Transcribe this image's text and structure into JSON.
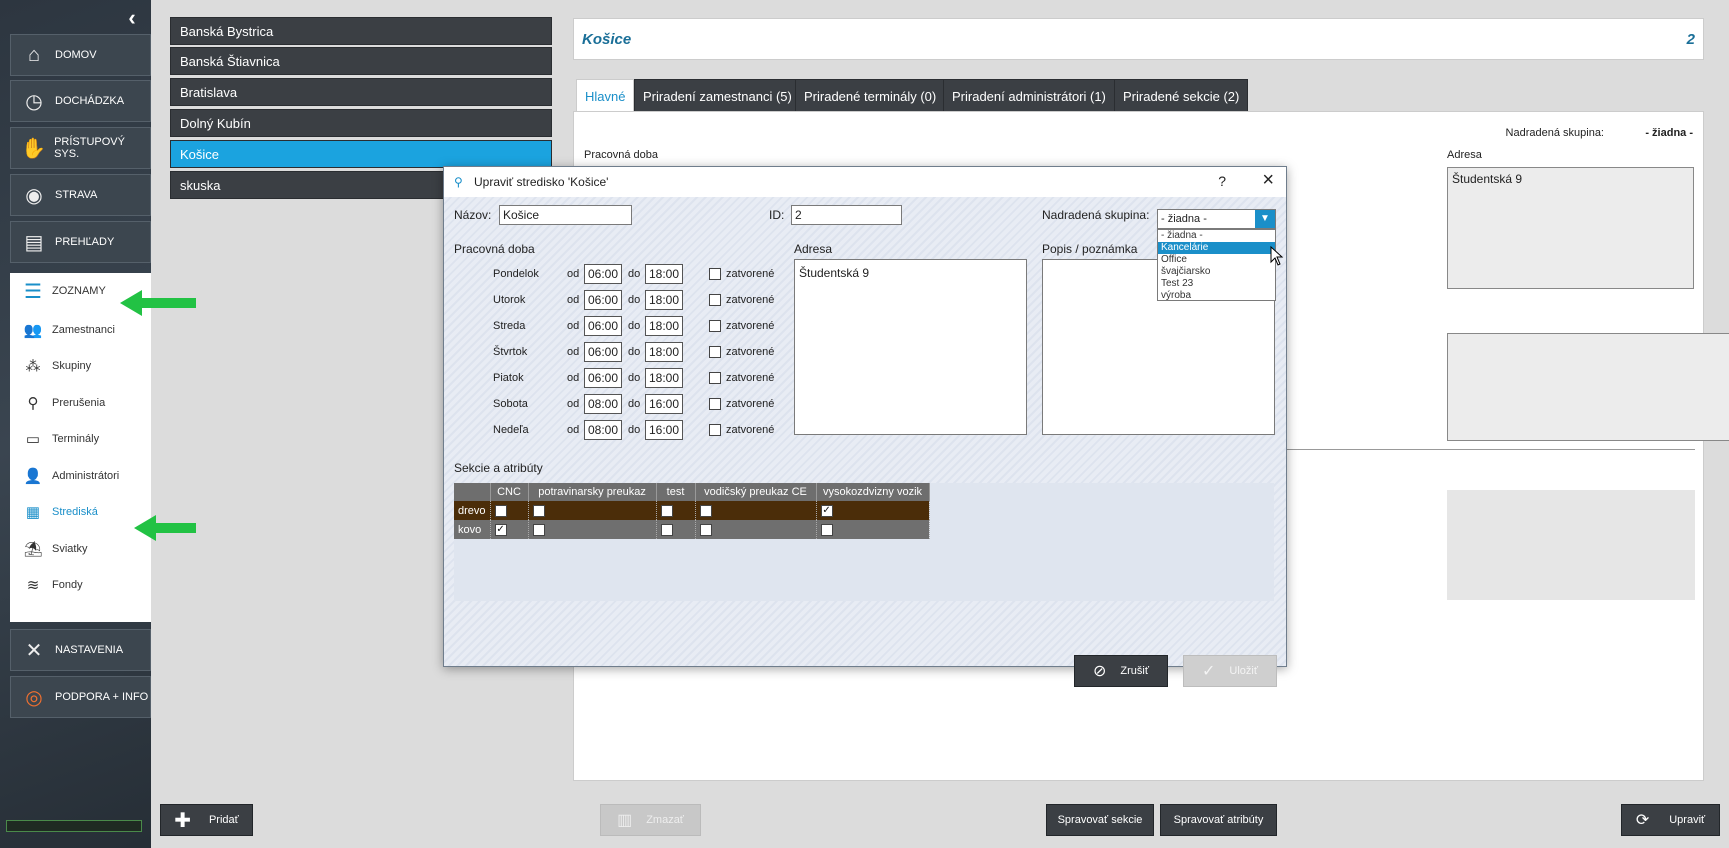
{
  "sidebar": {
    "collapse_icon": "chevron-left-icon",
    "nav": [
      {
        "label": "DOMOV",
        "icon": "home-icon"
      },
      {
        "label": "DOCHÁDZKA",
        "icon": "clock-icon"
      },
      {
        "label": "PRÍSTUPOVÝ SYS.",
        "icon": "handshake-icon"
      },
      {
        "label": "STRAVA",
        "icon": "plate-icon"
      },
      {
        "label": "PREHĽADY",
        "icon": "book-icon"
      }
    ],
    "submenu_head": "ZOZNAMY",
    "submenu": [
      {
        "label": "Zamestnanci"
      },
      {
        "label": "Skupiny"
      },
      {
        "label": "Prerušenia"
      },
      {
        "label": "Terminály"
      },
      {
        "label": "Administrátori"
      },
      {
        "label": "Strediská"
      },
      {
        "label": "Sviatky"
      },
      {
        "label": "Fondy"
      }
    ],
    "nav_bottom": [
      {
        "label": "NASTAVENIA",
        "icon": "tools-icon"
      },
      {
        "label": "PODPORA + INFO",
        "icon": "lifebuoy-icon"
      }
    ]
  },
  "list": [
    "Banská Bystrica",
    "Banská Štiavnica",
    "Bratislava",
    "Dolný Kubín",
    "Košice",
    "skuska"
  ],
  "detail": {
    "title": "Košice",
    "id": "2",
    "tabs": [
      "Hlavné",
      "Priradení zamestnanci (5)",
      "Priradené terminály (0)",
      "Priradení administrátori (1)",
      "Priradené sekcie (2)"
    ],
    "parent_label": "Nadradená skupina:",
    "parent_value": "- žiadna -",
    "work_label": "Pracovná doba",
    "address_label": "Adresa",
    "address_value": "Študentská 9"
  },
  "bottom": {
    "add": "Pridať",
    "delete": "Zmazať",
    "manage_sections": "Spravovať sekcie",
    "manage_attrs": "Spravovať atribúty",
    "edit": "Upraviť"
  },
  "dialog": {
    "title": "Upraviť stredisko 'Košice'",
    "help": "?",
    "name_label": "Názov:",
    "name_value": "Košice",
    "id_label": "ID:",
    "id_value": "2",
    "parent_label": "Nadradená skupina:",
    "parent_value": "- žiadna -",
    "work_label": "Pracovná doba",
    "od": "od",
    "do": "do",
    "closed": "zatvorené",
    "days": [
      {
        "day": "Pondelok",
        "from": "06:00",
        "to": "18:00"
      },
      {
        "day": "Utorok",
        "from": "06:00",
        "to": "18:00"
      },
      {
        "day": "Streda",
        "from": "06:00",
        "to": "18:00"
      },
      {
        "day": "Štvrtok",
        "from": "06:00",
        "to": "18:00"
      },
      {
        "day": "Piatok",
        "from": "06:00",
        "to": "18:00"
      },
      {
        "day": "Sobota",
        "from": "08:00",
        "to": "16:00"
      },
      {
        "day": "Nedeľa",
        "from": "08:00",
        "to": "16:00"
      }
    ],
    "address_label": "Adresa",
    "address_value": "Študentská 9",
    "note_label": "Popis / poznámka",
    "sections_label": "Sekcie a atribúty",
    "section_columns": [
      "CNC",
      "potravinarsky preukaz",
      "test",
      "vodičský preukaz CE",
      "vysokozdvizny vozik"
    ],
    "section_rows": [
      {
        "name": "drevo",
        "checks": [
          false,
          false,
          false,
          false,
          true
        ]
      },
      {
        "name": "kovo",
        "checks": [
          true,
          false,
          false,
          false,
          false
        ]
      }
    ],
    "cancel": "Zrušiť",
    "save": "Uložiť",
    "dropdown_options": [
      "- žiadna -",
      "Kancelárie",
      "Office",
      "švajčiarsko",
      "Test 23",
      "výroba"
    ],
    "dropdown_highlight": "Kancelárie"
  },
  "colors": {
    "accent": "#1a8fc9",
    "arrow": "#22c244"
  }
}
